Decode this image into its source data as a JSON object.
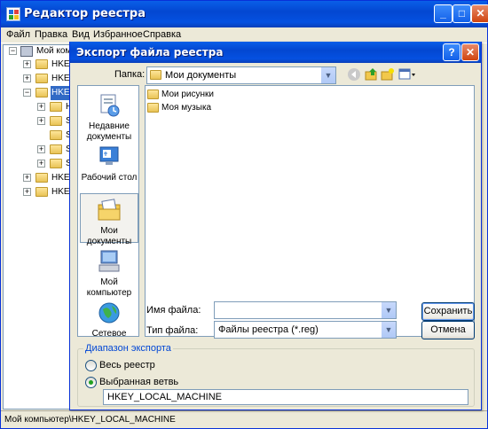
{
  "main_window": {
    "title": "Редактор реестра",
    "menu": [
      "Файл",
      "Правка",
      "Вид",
      "Избранное",
      "Справка"
    ],
    "tree": {
      "root": "Мой компьютер",
      "keys": [
        "HKEY_",
        "HKEY_",
        "HKEY_",
        "HA",
        "SA",
        "SE",
        "SC",
        "SY",
        "HKEY_",
        "HKEY_"
      ]
    },
    "status": "Мой компьютер\\HKEY_LOCAL_MACHINE"
  },
  "dialog": {
    "title": "Экспорт файла реестра",
    "folder_label": "Папка:",
    "folder_value": "Мои документы",
    "places": [
      {
        "label": "Недавние документы",
        "icon": "recent-documents-icon"
      },
      {
        "label": "Рабочий стол",
        "icon": "desktop-icon"
      },
      {
        "label": "Мои документы",
        "icon": "my-documents-icon"
      },
      {
        "label": "Мой компьютер",
        "icon": "my-computer-icon"
      },
      {
        "label": "Сетевое",
        "icon": "network-icon"
      }
    ],
    "files": [
      "Мои рисунки",
      "Моя музыка"
    ],
    "filename_label": "Имя файла:",
    "filename_value": "",
    "filetype_label": "Тип файла:",
    "filetype_value": "Файлы реестра (*.reg)",
    "save_button": "Сохранить",
    "cancel_button": "Отмена",
    "export_range": {
      "title": "Диапазон экспорта",
      "all_label": "Весь реестр",
      "selected_label": "Выбранная ветвь",
      "selected_branch": "HKEY_LOCAL_MACHINE",
      "selected": "Выбранная ветвь"
    }
  },
  "colors": {
    "titlebar": "#0a5fe8",
    "dialog_bg": "#ece9d8",
    "group_title": "#0046d5",
    "selection": "#316ac5"
  }
}
